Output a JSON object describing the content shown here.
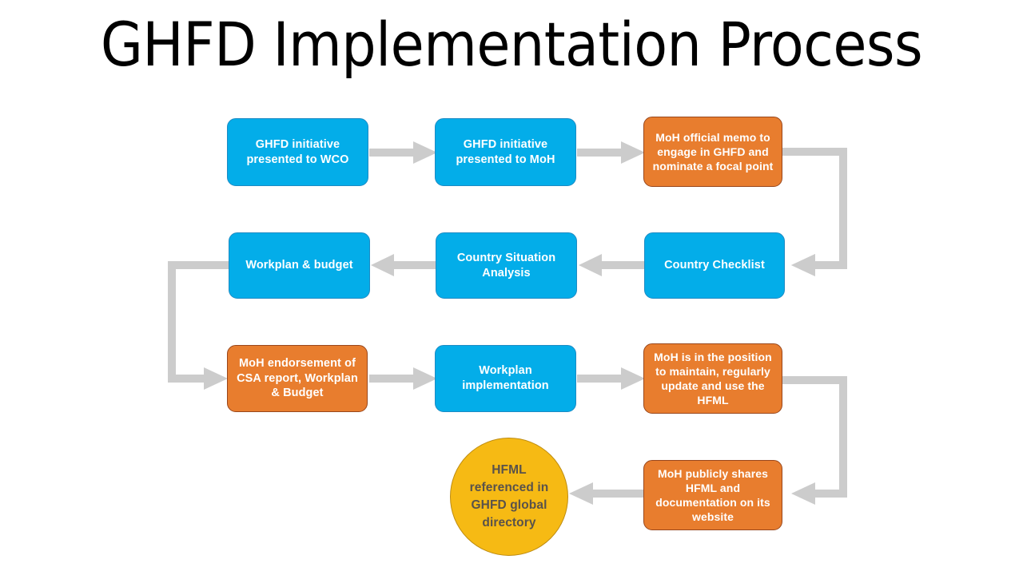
{
  "title": "GHFD Implementation Process",
  "colors": {
    "blue": "#03ADE9",
    "blue_border": "#1D8BC4",
    "orange": "#E87D2E",
    "orange_border": "#99471C",
    "yellow": "#F6BA14",
    "yellow_border": "#BE8C11",
    "arrow_gray": "#CCCCCC",
    "title_text": "#000000",
    "node_text": "#FFFFFF",
    "circle_text": "#59524B",
    "background": "#FFFFFF"
  },
  "nodes": [
    {
      "id": "ghfd-wco",
      "label": "GHFD initiative presented to WCO",
      "shape": "rounded-rect",
      "color": "blue",
      "row": 1
    },
    {
      "id": "ghfd-moh",
      "label": "GHFD initiative presented to MoH",
      "shape": "rounded-rect",
      "color": "blue",
      "row": 1
    },
    {
      "id": "moh-memo",
      "label": "MoH official memo to engage in GHFD and nominate a focal point",
      "shape": "rounded-rect",
      "color": "orange",
      "row": 1
    },
    {
      "id": "workplan-budget",
      "label": "Workplan & budget",
      "shape": "rounded-rect",
      "color": "blue",
      "row": 2
    },
    {
      "id": "country-situation",
      "label": "Country Situation Analysis",
      "shape": "rounded-rect",
      "color": "blue",
      "row": 2
    },
    {
      "id": "country-checklist",
      "label": "Country Checklist",
      "shape": "rounded-rect",
      "color": "blue",
      "row": 2
    },
    {
      "id": "moh-endorsement",
      "label": "MoH endorsement of CSA report, Workplan & Budget",
      "shape": "rounded-rect",
      "color": "orange",
      "row": 3
    },
    {
      "id": "workplan-impl",
      "label": "Workplan implementation",
      "shape": "rounded-rect",
      "color": "blue",
      "row": 3
    },
    {
      "id": "moh-maintain",
      "label": "MoH is in the position to maintain, regularly update and use the HFML",
      "shape": "rounded-rect",
      "color": "orange",
      "row": 3
    },
    {
      "id": "moh-publish",
      "label": "MoH publicly shares HFML and documentation on its website",
      "shape": "rounded-rect",
      "color": "orange",
      "row": 4
    },
    {
      "id": "hfml-directory",
      "label": "HFML referenced in GHFD global directory",
      "shape": "circle",
      "color": "yellow",
      "row": 4
    }
  ],
  "connectors": [
    {
      "id": "c1",
      "from": "ghfd-wco",
      "to": "ghfd-moh",
      "kind": "straight",
      "direction": "right"
    },
    {
      "id": "c2",
      "from": "ghfd-moh",
      "to": "moh-memo",
      "kind": "straight",
      "direction": "right"
    },
    {
      "id": "c3",
      "from": "moh-memo",
      "to": "country-checklist",
      "kind": "elbow",
      "direction": "right-down-left"
    },
    {
      "id": "c4",
      "from": "country-checklist",
      "to": "country-situation",
      "kind": "straight",
      "direction": "left"
    },
    {
      "id": "c5",
      "from": "country-situation",
      "to": "workplan-budget",
      "kind": "straight",
      "direction": "left"
    },
    {
      "id": "c6",
      "from": "workplan-budget",
      "to": "moh-endorsement",
      "kind": "elbow",
      "direction": "left-down-right"
    },
    {
      "id": "c7",
      "from": "moh-endorsement",
      "to": "workplan-impl",
      "kind": "straight",
      "direction": "right"
    },
    {
      "id": "c8",
      "from": "workplan-impl",
      "to": "moh-maintain",
      "kind": "straight",
      "direction": "right"
    },
    {
      "id": "c9",
      "from": "moh-maintain",
      "to": "moh-publish",
      "kind": "elbow",
      "direction": "right-down-left"
    },
    {
      "id": "c10",
      "from": "moh-publish",
      "to": "hfml-directory",
      "kind": "straight",
      "direction": "left"
    }
  ]
}
